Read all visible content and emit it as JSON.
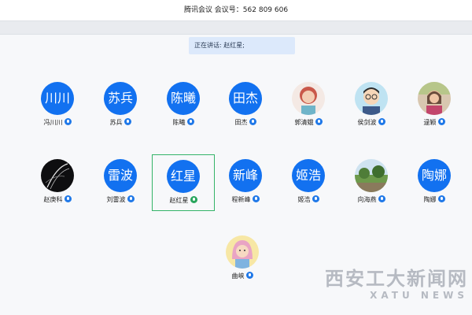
{
  "window": {
    "title": "腾讯会议 会议号：562 809 606"
  },
  "speaking_banner": "正在讲话: 赵红星;",
  "participants": [
    {
      "avatar_text": "川川",
      "name": "冯川川",
      "avatar_type": "text",
      "mic_icon": "mic-icon"
    },
    {
      "avatar_text": "苏兵",
      "name": "苏兵",
      "avatar_type": "text",
      "mic_icon": "mic-icon"
    },
    {
      "avatar_text": "陈曦",
      "name": "陈曦",
      "avatar_type": "text",
      "mic_icon": "mic-icon"
    },
    {
      "avatar_text": "田杰",
      "name": "田杰",
      "avatar_type": "text",
      "mic_icon": "mic-icon"
    },
    {
      "avatar_text": "",
      "name": "郭清娥",
      "avatar_type": "photo",
      "mic_icon": "mic-icon"
    },
    {
      "avatar_text": "",
      "name": "侯剑波",
      "avatar_type": "photo",
      "mic_icon": "mic-icon"
    },
    {
      "avatar_text": "",
      "name": "逯颖",
      "avatar_type": "photo",
      "mic_icon": "mic-icon"
    },
    {
      "avatar_text": "",
      "name": "赵庚科",
      "avatar_type": "photo",
      "mic_icon": "mic-icon"
    },
    {
      "avatar_text": "雷波",
      "name": "刘雷波",
      "avatar_type": "text",
      "mic_icon": "mic-icon"
    },
    {
      "avatar_text": "红星",
      "name": "赵红星",
      "avatar_type": "text",
      "mic_icon": "mic-speaking-icon",
      "active": true
    },
    {
      "avatar_text": "新峰",
      "name": "程新峰",
      "avatar_type": "text",
      "mic_icon": "mic-icon"
    },
    {
      "avatar_text": "姬浩",
      "name": "姬浩",
      "avatar_type": "text",
      "mic_icon": "mic-icon"
    },
    {
      "avatar_text": "",
      "name": "向海燕",
      "avatar_type": "photo",
      "mic_icon": "mic-icon"
    },
    {
      "avatar_text": "陶娜",
      "name": "陶娜",
      "avatar_type": "text",
      "mic_icon": "mic-icon"
    },
    {
      "avatar_text": "",
      "name": "曲峡",
      "avatar_type": "photo",
      "mic_icon": "mic-icon"
    }
  ],
  "watermark": {
    "title": "西安工大新闻网",
    "subtitle": "XATU NEWS"
  },
  "colors": {
    "avatar_blue": "#1271f0",
    "active_border": "#34b468",
    "banner_bg": "#dce9fb"
  }
}
